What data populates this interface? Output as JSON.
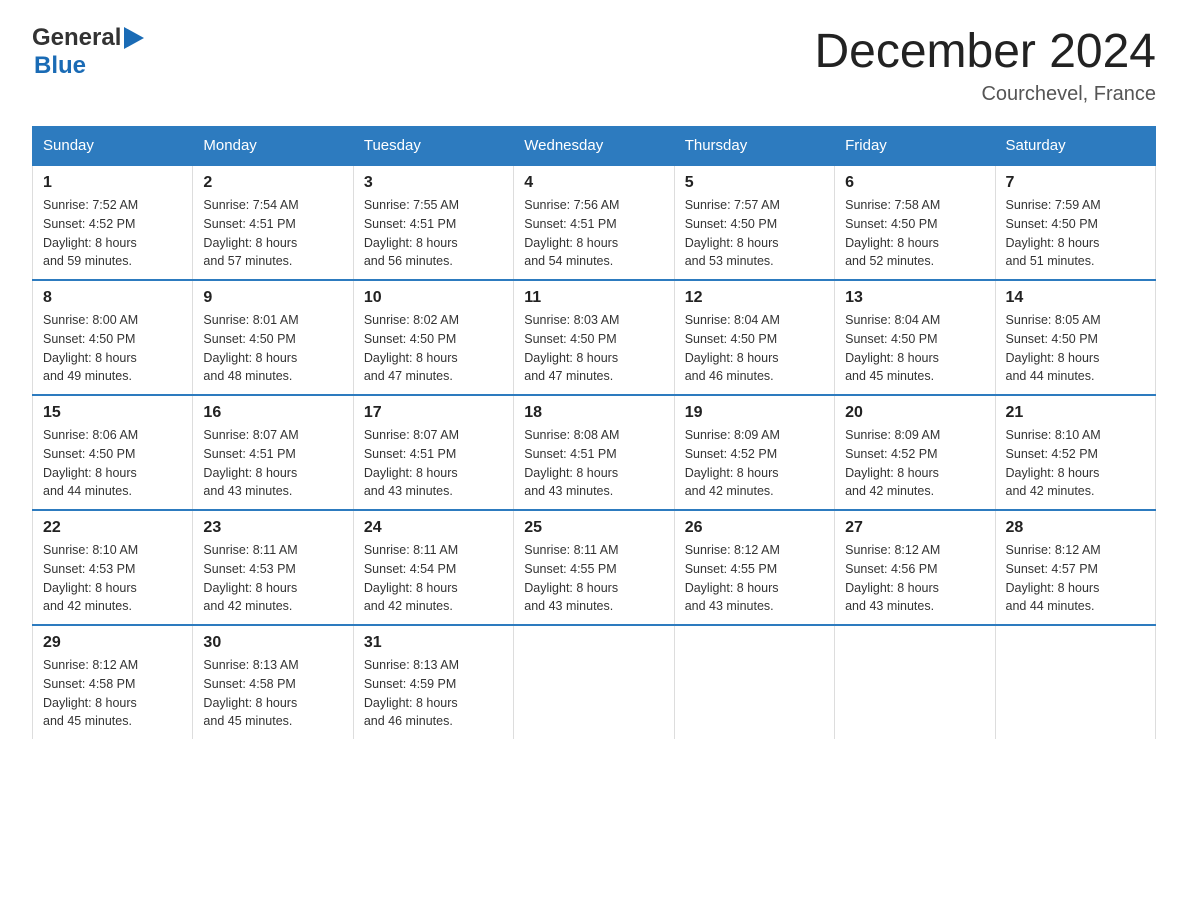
{
  "logo": {
    "line1": "General",
    "arrow": "▶",
    "line2": "Blue"
  },
  "title": "December 2024",
  "location": "Courchevel, France",
  "weekdays": [
    "Sunday",
    "Monday",
    "Tuesday",
    "Wednesday",
    "Thursday",
    "Friday",
    "Saturday"
  ],
  "weeks": [
    [
      {
        "day": "1",
        "info": "Sunrise: 7:52 AM\nSunset: 4:52 PM\nDaylight: 8 hours\nand 59 minutes."
      },
      {
        "day": "2",
        "info": "Sunrise: 7:54 AM\nSunset: 4:51 PM\nDaylight: 8 hours\nand 57 minutes."
      },
      {
        "day": "3",
        "info": "Sunrise: 7:55 AM\nSunset: 4:51 PM\nDaylight: 8 hours\nand 56 minutes."
      },
      {
        "day": "4",
        "info": "Sunrise: 7:56 AM\nSunset: 4:51 PM\nDaylight: 8 hours\nand 54 minutes."
      },
      {
        "day": "5",
        "info": "Sunrise: 7:57 AM\nSunset: 4:50 PM\nDaylight: 8 hours\nand 53 minutes."
      },
      {
        "day": "6",
        "info": "Sunrise: 7:58 AM\nSunset: 4:50 PM\nDaylight: 8 hours\nand 52 minutes."
      },
      {
        "day": "7",
        "info": "Sunrise: 7:59 AM\nSunset: 4:50 PM\nDaylight: 8 hours\nand 51 minutes."
      }
    ],
    [
      {
        "day": "8",
        "info": "Sunrise: 8:00 AM\nSunset: 4:50 PM\nDaylight: 8 hours\nand 49 minutes."
      },
      {
        "day": "9",
        "info": "Sunrise: 8:01 AM\nSunset: 4:50 PM\nDaylight: 8 hours\nand 48 minutes."
      },
      {
        "day": "10",
        "info": "Sunrise: 8:02 AM\nSunset: 4:50 PM\nDaylight: 8 hours\nand 47 minutes."
      },
      {
        "day": "11",
        "info": "Sunrise: 8:03 AM\nSunset: 4:50 PM\nDaylight: 8 hours\nand 47 minutes."
      },
      {
        "day": "12",
        "info": "Sunrise: 8:04 AM\nSunset: 4:50 PM\nDaylight: 8 hours\nand 46 minutes."
      },
      {
        "day": "13",
        "info": "Sunrise: 8:04 AM\nSunset: 4:50 PM\nDaylight: 8 hours\nand 45 minutes."
      },
      {
        "day": "14",
        "info": "Sunrise: 8:05 AM\nSunset: 4:50 PM\nDaylight: 8 hours\nand 44 minutes."
      }
    ],
    [
      {
        "day": "15",
        "info": "Sunrise: 8:06 AM\nSunset: 4:50 PM\nDaylight: 8 hours\nand 44 minutes."
      },
      {
        "day": "16",
        "info": "Sunrise: 8:07 AM\nSunset: 4:51 PM\nDaylight: 8 hours\nand 43 minutes."
      },
      {
        "day": "17",
        "info": "Sunrise: 8:07 AM\nSunset: 4:51 PM\nDaylight: 8 hours\nand 43 minutes."
      },
      {
        "day": "18",
        "info": "Sunrise: 8:08 AM\nSunset: 4:51 PM\nDaylight: 8 hours\nand 43 minutes."
      },
      {
        "day": "19",
        "info": "Sunrise: 8:09 AM\nSunset: 4:52 PM\nDaylight: 8 hours\nand 42 minutes."
      },
      {
        "day": "20",
        "info": "Sunrise: 8:09 AM\nSunset: 4:52 PM\nDaylight: 8 hours\nand 42 minutes."
      },
      {
        "day": "21",
        "info": "Sunrise: 8:10 AM\nSunset: 4:52 PM\nDaylight: 8 hours\nand 42 minutes."
      }
    ],
    [
      {
        "day": "22",
        "info": "Sunrise: 8:10 AM\nSunset: 4:53 PM\nDaylight: 8 hours\nand 42 minutes."
      },
      {
        "day": "23",
        "info": "Sunrise: 8:11 AM\nSunset: 4:53 PM\nDaylight: 8 hours\nand 42 minutes."
      },
      {
        "day": "24",
        "info": "Sunrise: 8:11 AM\nSunset: 4:54 PM\nDaylight: 8 hours\nand 42 minutes."
      },
      {
        "day": "25",
        "info": "Sunrise: 8:11 AM\nSunset: 4:55 PM\nDaylight: 8 hours\nand 43 minutes."
      },
      {
        "day": "26",
        "info": "Sunrise: 8:12 AM\nSunset: 4:55 PM\nDaylight: 8 hours\nand 43 minutes."
      },
      {
        "day": "27",
        "info": "Sunrise: 8:12 AM\nSunset: 4:56 PM\nDaylight: 8 hours\nand 43 minutes."
      },
      {
        "day": "28",
        "info": "Sunrise: 8:12 AM\nSunset: 4:57 PM\nDaylight: 8 hours\nand 44 minutes."
      }
    ],
    [
      {
        "day": "29",
        "info": "Sunrise: 8:12 AM\nSunset: 4:58 PM\nDaylight: 8 hours\nand 45 minutes."
      },
      {
        "day": "30",
        "info": "Sunrise: 8:13 AM\nSunset: 4:58 PM\nDaylight: 8 hours\nand 45 minutes."
      },
      {
        "day": "31",
        "info": "Sunrise: 8:13 AM\nSunset: 4:59 PM\nDaylight: 8 hours\nand 46 minutes."
      },
      null,
      null,
      null,
      null
    ]
  ]
}
